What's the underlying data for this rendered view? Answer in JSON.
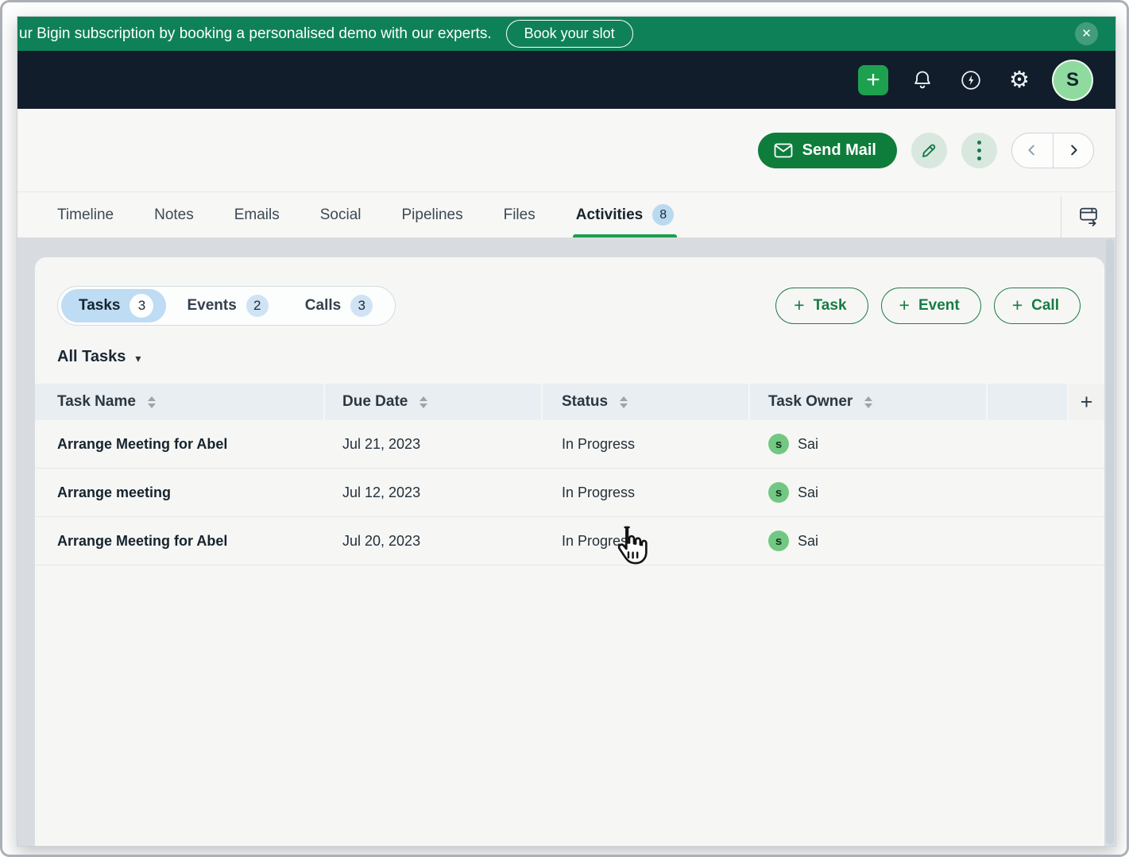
{
  "banner": {
    "text": "ur Bigin subscription by booking a personalised demo with our experts.",
    "cta_label": "Book your slot"
  },
  "navbar": {
    "avatar_initial": "S"
  },
  "toolbar": {
    "send_mail_label": "Send Mail"
  },
  "tabs": {
    "items": [
      {
        "label": "Timeline"
      },
      {
        "label": "Notes"
      },
      {
        "label": "Emails"
      },
      {
        "label": "Social"
      },
      {
        "label": "Pipelines"
      },
      {
        "label": "Files"
      },
      {
        "label": "Activities",
        "badge": "8"
      }
    ]
  },
  "activity_filters": {
    "segments": [
      {
        "label": "Tasks",
        "count": "3",
        "selected": true
      },
      {
        "label": "Events",
        "count": "2",
        "selected": false
      },
      {
        "label": "Calls",
        "count": "3",
        "selected": false
      }
    ],
    "add_buttons": [
      {
        "label": "Task"
      },
      {
        "label": "Event"
      },
      {
        "label": "Call"
      }
    ],
    "view_label": "All Tasks"
  },
  "table": {
    "columns": [
      {
        "label": "Task Name"
      },
      {
        "label": "Due Date"
      },
      {
        "label": "Status"
      },
      {
        "label": "Task Owner"
      }
    ],
    "rows": [
      {
        "name": "Arrange Meeting for Abel",
        "due_date": "Jul 21, 2023",
        "status": "In Progress",
        "owner": "Sai",
        "owner_initial": "s"
      },
      {
        "name": "Arrange meeting",
        "due_date": "Jul 12, 2023",
        "status": "In Progress",
        "owner": "Sai",
        "owner_initial": "s"
      },
      {
        "name": "Arrange Meeting for Abel",
        "due_date": "Jul 20, 2023",
        "status": "In Progress",
        "owner": "Sai",
        "owner_initial": "s"
      }
    ]
  },
  "icons": {
    "close": "✕",
    "plus": "+",
    "caret_down": "▾",
    "gear": "⚙"
  },
  "colors": {
    "banner_green": "#0f8158",
    "navbar_dark": "#111d2b",
    "primary_button_green": "#0e7d3c",
    "active_tab_green": "#1f9e4f",
    "badge_blue": "#bedcf3",
    "avatar_green": "#8fdb9f",
    "owner_avatar_green": "#72c882"
  }
}
